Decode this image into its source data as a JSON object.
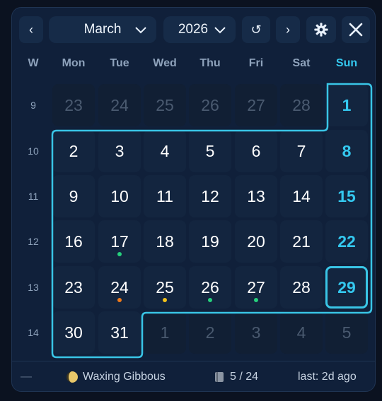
{
  "header": {
    "prev_label": "‹",
    "next_label": "›",
    "month": "March",
    "year": "2026",
    "refresh_label": "↺"
  },
  "weekdays": [
    "W",
    "Mon",
    "Tue",
    "Wed",
    "Thu",
    "Fri",
    "Sat",
    "Sun"
  ],
  "weeks": [
    {
      "w": "9",
      "days": [
        {
          "d": "23",
          "dim": true
        },
        {
          "d": "24",
          "dim": true
        },
        {
          "d": "25",
          "dim": true
        },
        {
          "d": "26",
          "dim": true
        },
        {
          "d": "27",
          "dim": true
        },
        {
          "d": "28",
          "dim": true
        },
        {
          "d": "1",
          "sun": true
        }
      ]
    },
    {
      "w": "10",
      "days": [
        {
          "d": "2"
        },
        {
          "d": "3"
        },
        {
          "d": "4"
        },
        {
          "d": "5"
        },
        {
          "d": "6"
        },
        {
          "d": "7"
        },
        {
          "d": "8",
          "sun": true
        }
      ]
    },
    {
      "w": "11",
      "days": [
        {
          "d": "9"
        },
        {
          "d": "10"
        },
        {
          "d": "11"
        },
        {
          "d": "12"
        },
        {
          "d": "13"
        },
        {
          "d": "14"
        },
        {
          "d": "15",
          "sun": true
        }
      ]
    },
    {
      "w": "12",
      "days": [
        {
          "d": "16"
        },
        {
          "d": "17",
          "dot": "#26d07c"
        },
        {
          "d": "18"
        },
        {
          "d": "19"
        },
        {
          "d": "20"
        },
        {
          "d": "21"
        },
        {
          "d": "22",
          "sun": true
        }
      ]
    },
    {
      "w": "13",
      "days": [
        {
          "d": "23"
        },
        {
          "d": "24",
          "dot": "#f07a1a"
        },
        {
          "d": "25",
          "dot": "#f2c21b"
        },
        {
          "d": "26",
          "dot": "#26d07c"
        },
        {
          "d": "27",
          "dot": "#26d07c"
        },
        {
          "d": "28"
        },
        {
          "d": "29",
          "sun": true,
          "today": true
        }
      ]
    },
    {
      "w": "14",
      "days": [
        {
          "d": "30"
        },
        {
          "d": "31"
        },
        {
          "d": "1",
          "dim": true
        },
        {
          "d": "2",
          "dim": true
        },
        {
          "d": "3",
          "dim": true
        },
        {
          "d": "4",
          "dim": true
        },
        {
          "d": "5",
          "dim": true
        }
      ]
    }
  ],
  "footer": {
    "left": "—",
    "moon_phase": "Waxing Gibbous",
    "count": "5 / 24",
    "last": "last: 2d ago"
  },
  "colors": {
    "accent": "#34c8ef",
    "outline": "#39c5e6"
  }
}
